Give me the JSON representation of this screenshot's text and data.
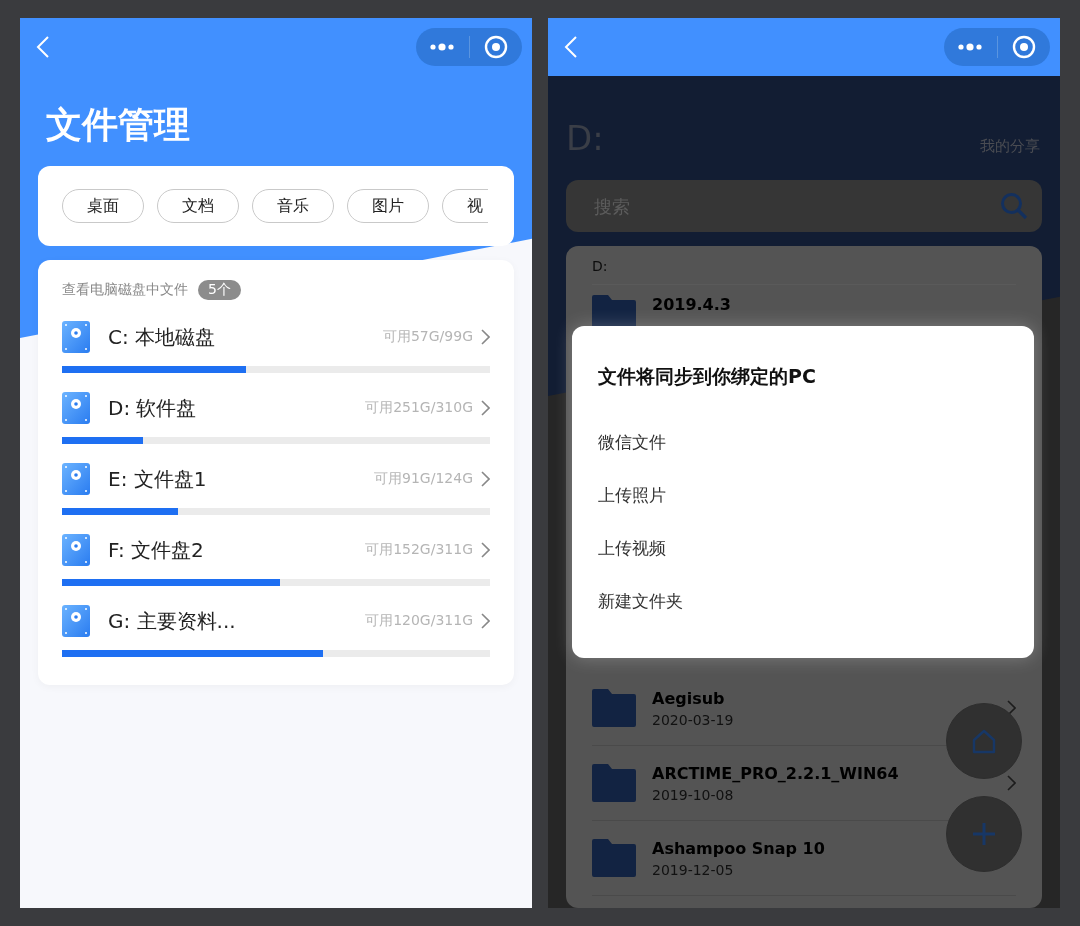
{
  "left": {
    "title": "文件管理",
    "categories": [
      "桌面",
      "文档",
      "音乐",
      "图片",
      "视"
    ],
    "disks_heading": "查看电脑磁盘中文件",
    "disks_count": "5个",
    "disks": [
      {
        "name": "C: 本地磁盘",
        "usage": "可用57G/99G",
        "level": 0.43
      },
      {
        "name": "D: 软件盘",
        "usage": "可用251G/310G",
        "level": 0.19
      },
      {
        "name": "E: 文件盘1",
        "usage": "可用91G/124G",
        "level": 0.27
      },
      {
        "name": "F: 文件盘2",
        "usage": "可用152G/311G",
        "level": 0.51
      },
      {
        "name": "G: 主要资料...",
        "usage": "可用120G/311G",
        "level": 0.61
      }
    ]
  },
  "right": {
    "title": "D:",
    "share_link": "我的分享",
    "search": {
      "placeholder": "搜索"
    },
    "path": "D:",
    "folders_top": [
      {
        "name": "2019.4.3"
      }
    ],
    "folders_bottom": [
      {
        "name": "Aegisub",
        "date": "2020-03-19"
      },
      {
        "name": "ARCTIME_PRO_2.2.1_WIN64",
        "date": "2019-10-08"
      },
      {
        "name": "Ashampoo Snap 10",
        "date": "2019-12-05"
      }
    ],
    "dialog": {
      "title": "文件将同步到你绑定的PC",
      "options": [
        "微信文件",
        "上传照片",
        "上传视频",
        "新建文件夹"
      ]
    }
  }
}
